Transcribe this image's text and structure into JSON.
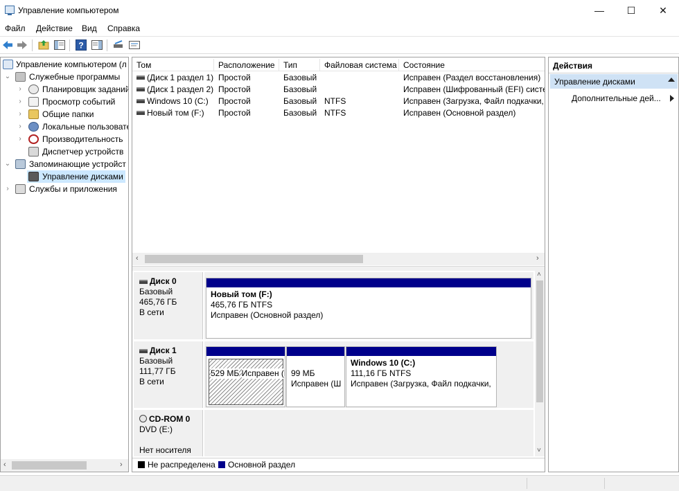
{
  "window": {
    "title": "Управление компьютером",
    "min_glyph": "—",
    "max_glyph": "☐",
    "close_glyph": "✕"
  },
  "menu": [
    "Файл",
    "Действие",
    "Вид",
    "Справка"
  ],
  "tree": {
    "root": "Управление компьютером (л",
    "groups": [
      {
        "label": "Служебные программы",
        "children": [
          "Планировщик заданий",
          "Просмотр событий",
          "Общие папки",
          "Локальные пользовате",
          "Производительность",
          "Диспетчер устройств"
        ]
      },
      {
        "label": "Запоминающие устройст",
        "children": [
          "Управление дисками"
        ]
      },
      {
        "label": "Службы и приложения",
        "children": []
      }
    ]
  },
  "volumes": {
    "columns": [
      "Том",
      "Расположение",
      "Тип",
      "Файловая система",
      "Состояние"
    ],
    "rows": [
      [
        "(Диск 1 раздел 1)",
        "Простой",
        "Базовый",
        "",
        "Исправен (Раздел восстановления)"
      ],
      [
        "(Диск 1 раздел 2)",
        "Простой",
        "Базовый",
        "",
        "Исправен (Шифрованный (EFI) систе"
      ],
      [
        "Windows 10 (C:)",
        "Простой",
        "Базовый",
        "NTFS",
        "Исправен (Загрузка, Файл подкачки,"
      ],
      [
        "Новый том (F:)",
        "Простой",
        "Базовый",
        "NTFS",
        "Исправен (Основной раздел)"
      ]
    ]
  },
  "disks": [
    {
      "name": "Диск 0",
      "type": "Базовый",
      "size": "465,76 ГБ",
      "status": "В сети",
      "partitions": [
        {
          "title": "Новый том  (F:)",
          "size": "465,76 ГБ NTFS",
          "status": "Исправен (Основной раздел)"
        }
      ]
    },
    {
      "name": "Диск 1",
      "type": "Базовый",
      "size": "111,77 ГБ",
      "status": "В сети",
      "partitions": [
        {
          "title": "",
          "size": "529 МБ",
          "status": "Исправен (Раздел"
        },
        {
          "title": "",
          "size": "99 МБ",
          "status": "Исправен (Ш"
        },
        {
          "title": "Windows 10  (C:)",
          "size": "111,16 ГБ NTFS",
          "status": "Исправен (Загрузка, Файл подкачки,"
        }
      ]
    },
    {
      "name": "CD-ROM 0",
      "type": "DVD (E:)",
      "size": "",
      "status": "Нет носителя",
      "partitions": []
    }
  ],
  "legend": [
    {
      "label": "Не распределена",
      "color": "#000000"
    },
    {
      "label": "Основной раздел",
      "color": "#00008b"
    }
  ],
  "actions": {
    "title": "Действия",
    "section": "Управление дисками",
    "item": "Дополнительные дей..."
  },
  "colors": {
    "selection": "#cce8ff",
    "partition_bar": "#00008b",
    "actions_section": "#cfe2f5"
  }
}
